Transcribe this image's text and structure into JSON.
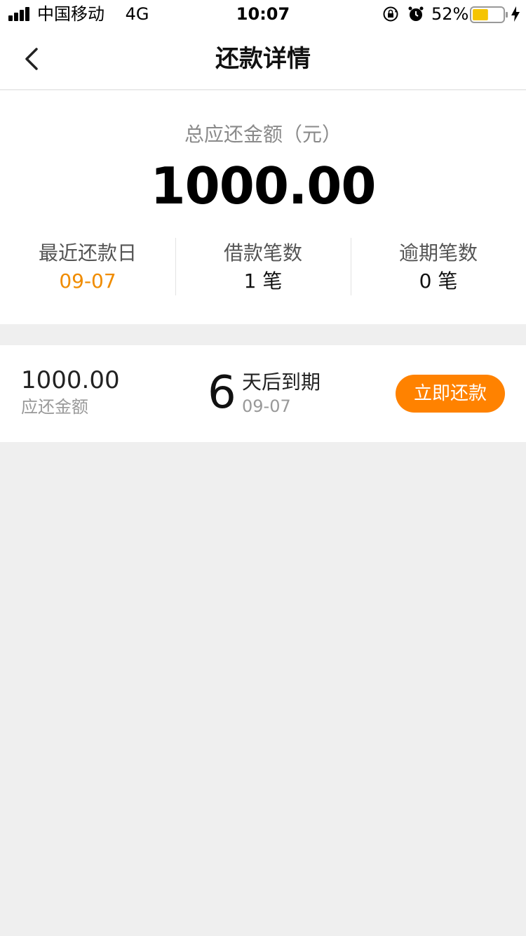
{
  "status_bar": {
    "carrier": "中国移动",
    "network": "4G",
    "time": "10:07",
    "battery_percent": "52%",
    "battery_level": 0.52,
    "battery_color": "#f5c400"
  },
  "nav": {
    "back_icon": "chevron-left-icon",
    "title": "还款详情"
  },
  "summary": {
    "total_label": "总应还金额（元）",
    "total_amount": "1000.00",
    "stats": [
      {
        "label": "最近还款日",
        "value": "09-07",
        "value_color": "#f08c00"
      },
      {
        "label": "借款笔数",
        "value": "1 笔"
      },
      {
        "label": "逾期笔数",
        "value": "0 笔"
      }
    ]
  },
  "bill": {
    "amount": "1000.00",
    "amount_label": "应还金额",
    "days": "6",
    "days_text": "天后到期",
    "due_date": "09-07",
    "pay_button": "立即还款",
    "accent_color": "#ff8200"
  }
}
